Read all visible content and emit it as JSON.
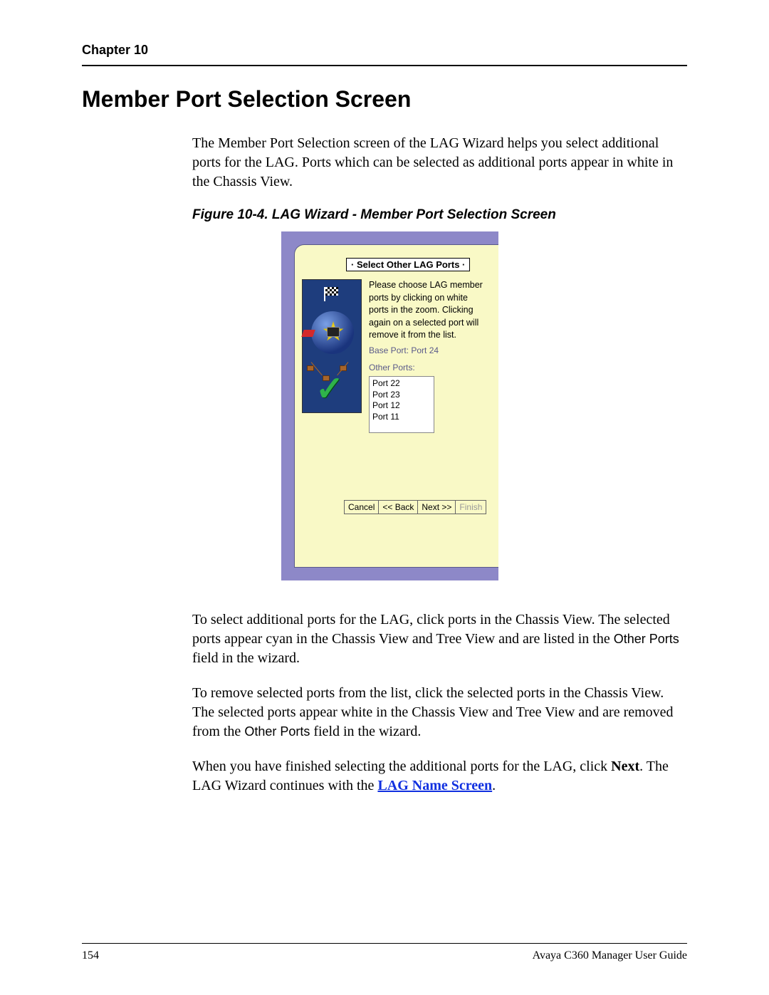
{
  "header": {
    "chapter": "Chapter 10"
  },
  "section": {
    "title": "Member Port Selection Screen"
  },
  "intro": "The Member Port Selection screen of the LAG Wizard helps you select additional ports for the LAG. Ports which can be selected as additional ports appear in white in the Chassis View.",
  "figure": {
    "caption": "Figure 10-4. LAG Wizard - Member Port Selection Screen",
    "wizard": {
      "header": "· Select Other LAG Ports ·",
      "instructions": "Please choose LAG member ports by clicking on white ports in the zoom. Clicking again on a selected port will remove it from the list.",
      "base_port_label": "Base Port:  Port 24",
      "other_ports_label": "Other Ports:",
      "ports": [
        "Port 22",
        "Port 23",
        "Port 12",
        "Port 11"
      ],
      "buttons": {
        "cancel": "Cancel",
        "back": "<< Back",
        "next": "Next >>",
        "finish": "Finish"
      }
    }
  },
  "para2_a": "To select additional ports for the LAG, click ports in the Chassis View. The selected ports appear cyan in the Chassis View and Tree View and are listed in the ",
  "para2_b": "Other Ports",
  "para2_c": " field in the wizard.",
  "para3_a": "To remove selected ports from the list, click the selected ports in the Chassis View. The selected ports appear white in the Chassis View and Tree View and are removed from the ",
  "para3_b": "Other Ports",
  "para3_c": " field in the wizard.",
  "para4_a": "When you have finished selecting the additional ports for the LAG, click ",
  "para4_b": "Next",
  "para4_c": ". The LAG Wizard continues with the ",
  "para4_link": "LAG Name Screen",
  "para4_d": ".",
  "footer": {
    "page": "154",
    "doc": "Avaya C360 Manager User Guide"
  }
}
